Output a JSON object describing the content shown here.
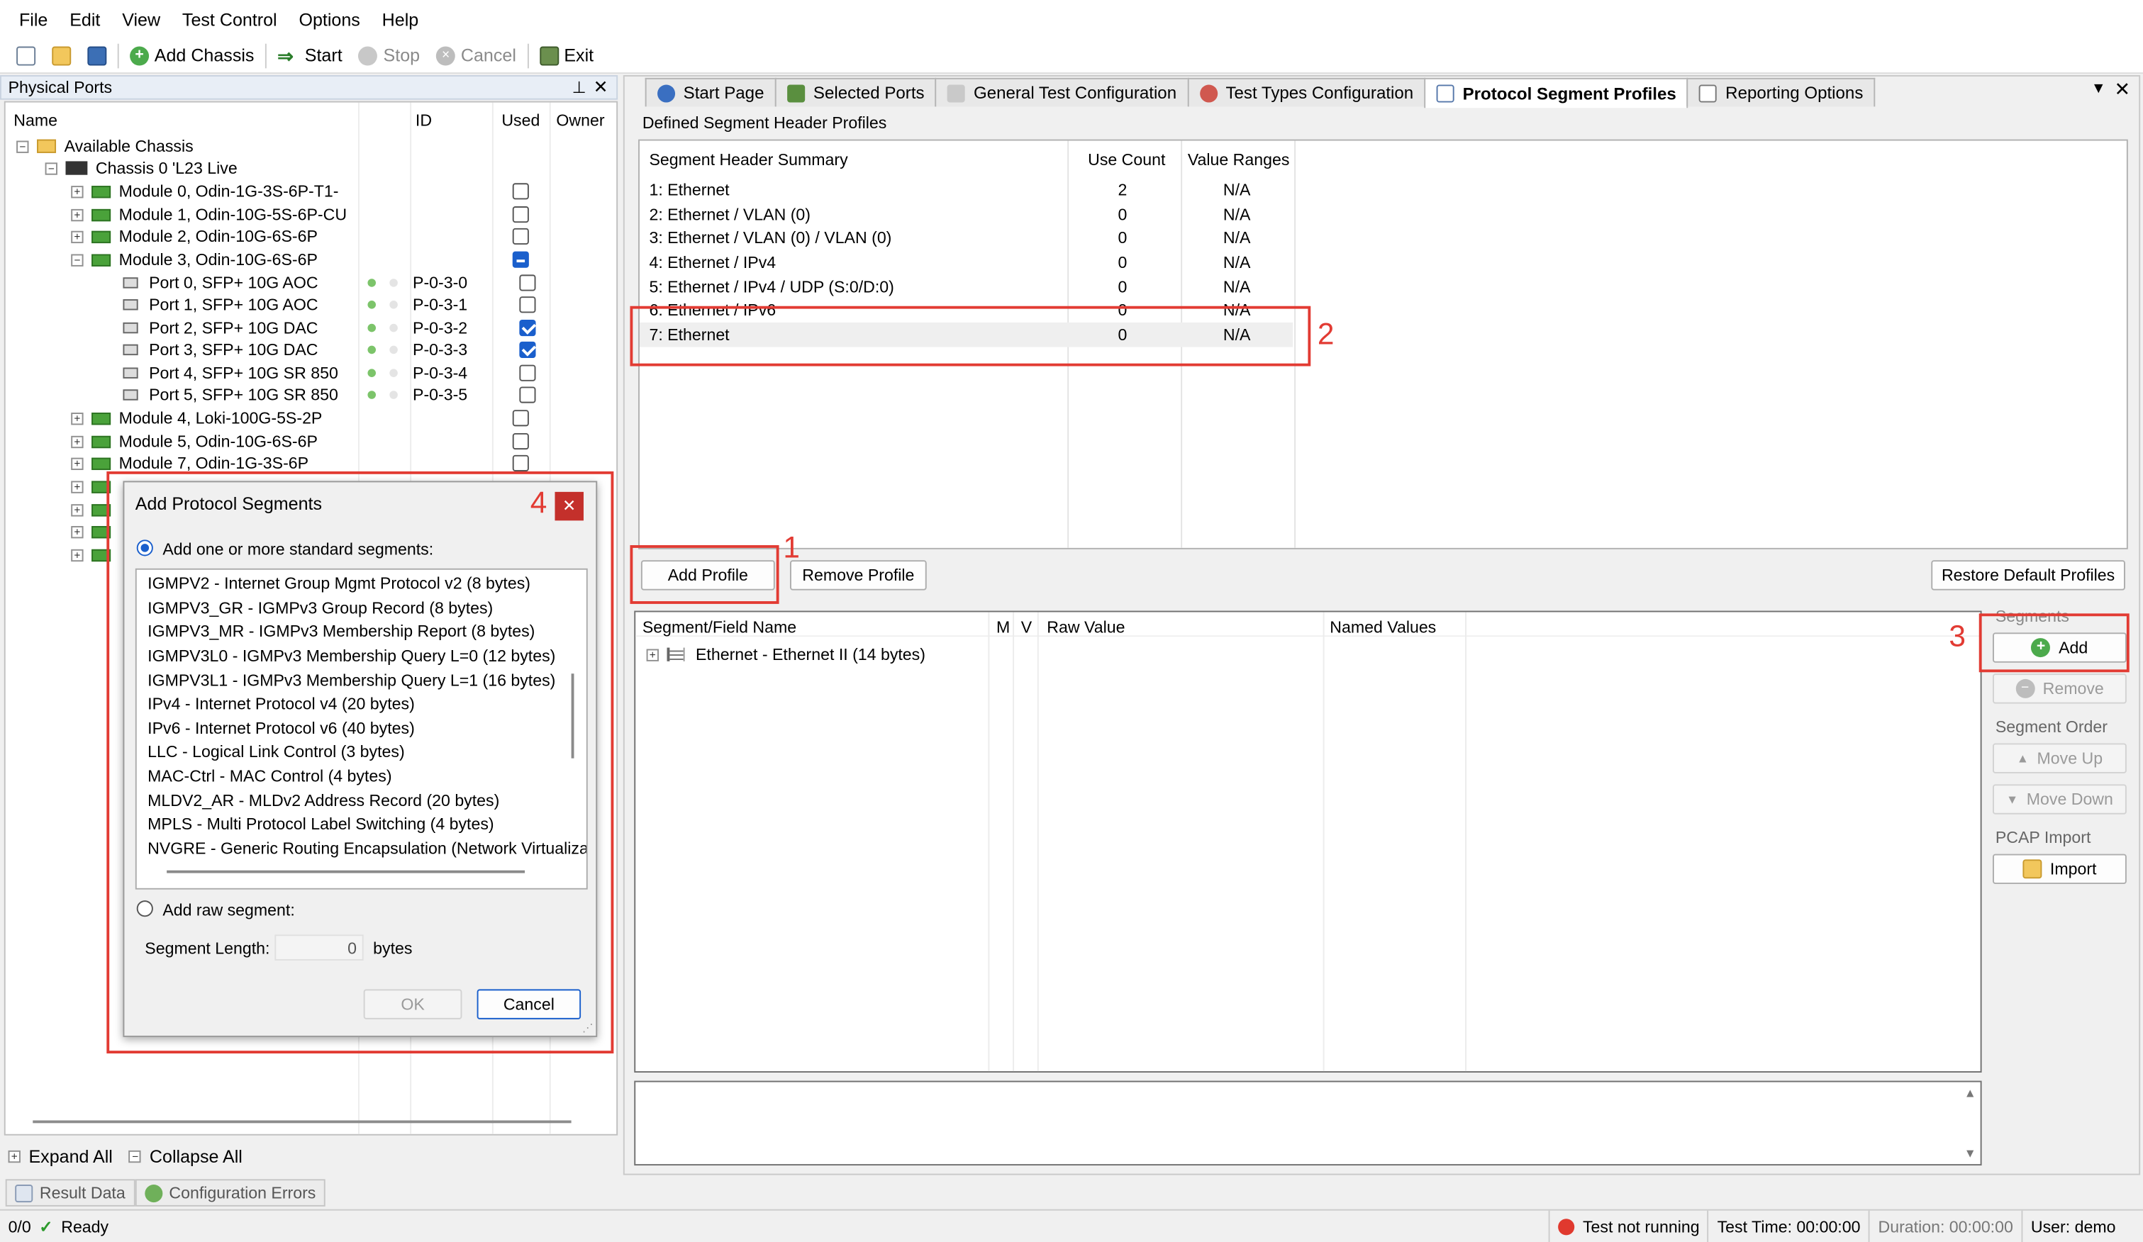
{
  "menu": [
    "File",
    "Edit",
    "View",
    "Test Control",
    "Options",
    "Help"
  ],
  "toolbar": {
    "add_chassis": "Add Chassis",
    "start": "Start",
    "stop": "Stop",
    "cancel": "Cancel",
    "exit": "Exit"
  },
  "left_panel": {
    "title": "Physical Ports",
    "col_name": "Name",
    "col_id": "ID",
    "col_used": "Used",
    "col_owner": "Owner",
    "available": "Available Chassis",
    "chassis": "Chassis 0 'L23 Live",
    "modules_top": [
      "Module 0, Odin-1G-3S-6P-T1-",
      "Module 1, Odin-10G-5S-6P-CU",
      "Module 2, Odin-10G-6S-6P",
      "Module 3, Odin-10G-6S-6P"
    ],
    "ports": [
      {
        "name": "Port 0, SFP+ 10G AOC",
        "id": "P-0-3-0",
        "used": false
      },
      {
        "name": "Port 1, SFP+ 10G AOC",
        "id": "P-0-3-1",
        "used": false
      },
      {
        "name": "Port 2, SFP+ 10G DAC",
        "id": "P-0-3-2",
        "used": true
      },
      {
        "name": "Port 3, SFP+ 10G DAC",
        "id": "P-0-3-3",
        "used": true
      },
      {
        "name": "Port 4, SFP+ 10G SR 850",
        "id": "P-0-3-4",
        "used": false
      },
      {
        "name": "Port 5, SFP+ 10G SR 850",
        "id": "P-0-3-5",
        "used": false
      }
    ],
    "modules_bottom": [
      "Module 4, Loki-100G-5S-2P",
      "Module 5, Odin-10G-6S-6P",
      "Module 7, Odin-1G-3S-6P"
    ],
    "expand_all": "Expand All",
    "collapse_all": "Collapse All"
  },
  "bottom_tabs": [
    "Result Data",
    "Configuration Errors"
  ],
  "status": {
    "count": "0/0",
    "ready": "Ready",
    "test_state": "Test not running",
    "test_time": "Test Time: 00:00:00",
    "duration": "Duration: 00:00:00",
    "user": "User: demo"
  },
  "tabs": [
    "Start Page",
    "Selected Ports",
    "General Test Configuration",
    "Test Types Configuration",
    "Protocol Segment Profiles",
    "Reporting Options"
  ],
  "active_tab": "Protocol Segment Profiles",
  "profiles": {
    "group_title": "Defined Segment Header Profiles",
    "col_summary": "Segment Header Summary",
    "col_use": "Use Count",
    "col_ranges": "Value Ranges",
    "rows": [
      {
        "summary": "1: Ethernet",
        "use": "2",
        "ranges": "N/A"
      },
      {
        "summary": "2: Ethernet / VLAN (0)",
        "use": "0",
        "ranges": "N/A"
      },
      {
        "summary": "3: Ethernet / VLAN (0) / VLAN (0)",
        "use": "0",
        "ranges": "N/A"
      },
      {
        "summary": "4: Ethernet / IPv4",
        "use": "0",
        "ranges": "N/A"
      },
      {
        "summary": "5: Ethernet / IPv4 / UDP (S:0/D:0)",
        "use": "0",
        "ranges": "N/A"
      },
      {
        "summary": "6: Ethernet / IPv6",
        "use": "0",
        "ranges": "N/A"
      },
      {
        "summary": "7: Ethernet",
        "use": "0",
        "ranges": "N/A"
      }
    ],
    "add_profile": "Add Profile",
    "remove_profile": "Remove Profile",
    "restore_defaults": "Restore Default Profiles"
  },
  "segments": {
    "col_field": "Segment/Field Name",
    "col_m": "M",
    "col_v": "V",
    "col_raw": "Raw Value",
    "col_named": "Named Values",
    "row": "Ethernet - Ethernet II (14 bytes)"
  },
  "side": {
    "segments_label": "Segments",
    "add": "Add",
    "remove": "Remove",
    "order_label": "Segment Order",
    "move_up": "Move Up",
    "move_down": "Move Down",
    "pcap_label": "PCAP Import",
    "import": "Import"
  },
  "annotations": [
    "1",
    "2",
    "3",
    "4"
  ],
  "dialog": {
    "title": "Add Protocol Segments",
    "opt_standard": "Add one or more standard segments:",
    "items": [
      "IGMPV2 - Internet Group Mgmt Protocol v2 (8 bytes)",
      "IGMPV3_GR - IGMPv3 Group Record (8 bytes)",
      "IGMPV3_MR - IGMPv3 Membership Report (8 bytes)",
      "IGMPV3L0 - IGMPv3 Membership Query L=0 (12 bytes)",
      "IGMPV3L1 - IGMPv3 Membership Query L=1 (16 bytes)",
      "IPv4 - Internet Protocol v4 (20 bytes)",
      "IPv6 - Internet Protocol v6 (40 bytes)",
      "LLC - Logical Link Control (3 bytes)",
      "MAC-Ctrl - MAC Control (4 bytes)",
      "MLDV2_AR - MLDv2 Address Record (20 bytes)",
      "MPLS - Multi Protocol Label Switching (4 bytes)",
      "NVGRE - Generic Routing Encapsulation (Network Virtualizati"
    ],
    "opt_raw": "Add raw segment:",
    "seg_len_label": "Segment Length:",
    "seg_len_value": "0",
    "bytes": "bytes",
    "ok": "OK",
    "cancel": "Cancel"
  },
  "colors": {
    "accent": "#1a5fcc",
    "annotation": "#e23b33",
    "close": "#c4302b"
  }
}
